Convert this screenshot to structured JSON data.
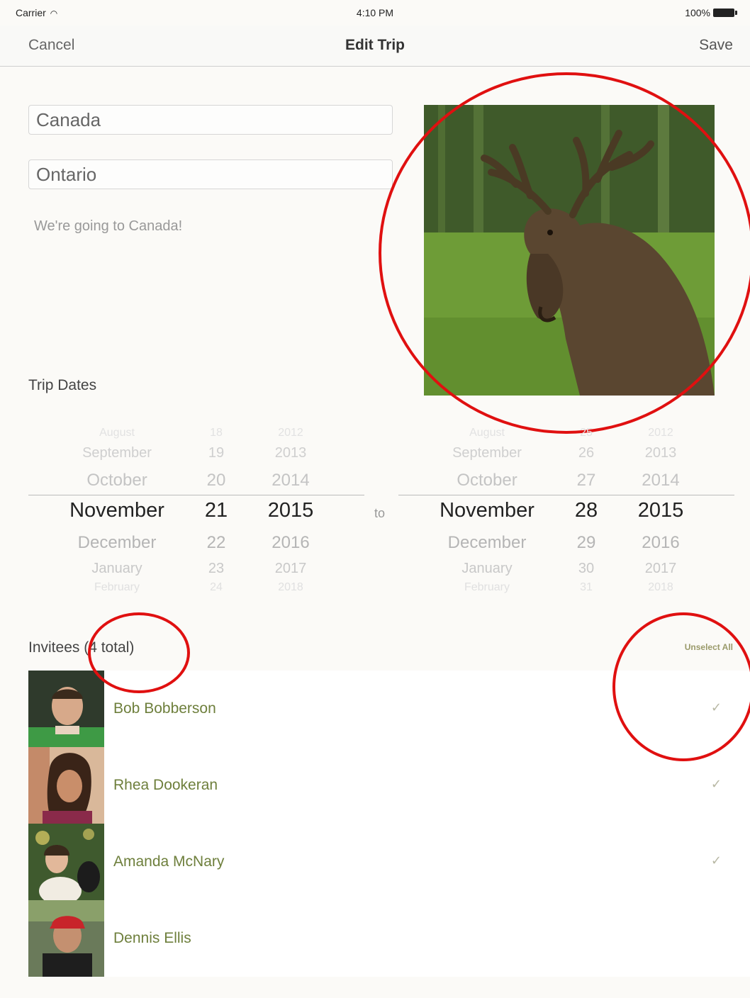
{
  "status_bar": {
    "carrier": "Carrier",
    "time": "4:10 PM",
    "battery": "100%"
  },
  "nav": {
    "cancel": "Cancel",
    "title": "Edit Trip",
    "save": "Save"
  },
  "form": {
    "country": "Canada",
    "region": "Ontario",
    "notes": "We're going to Canada!"
  },
  "trip_dates": {
    "title": "Trip Dates",
    "to_label": "to",
    "start": {
      "months": [
        "August",
        "September",
        "October",
        "November",
        "December",
        "January",
        "February"
      ],
      "days": [
        "18",
        "19",
        "20",
        "21",
        "22",
        "23",
        "24"
      ],
      "years": [
        "2012",
        "2013",
        "2014",
        "2015",
        "2016",
        "2017",
        "2018"
      ]
    },
    "end": {
      "months": [
        "August",
        "September",
        "October",
        "November",
        "December",
        "January",
        "February"
      ],
      "days": [
        "25",
        "26",
        "27",
        "28",
        "29",
        "30",
        "31"
      ],
      "years": [
        "2012",
        "2013",
        "2014",
        "2015",
        "2016",
        "2017",
        "2018"
      ]
    }
  },
  "invitees": {
    "title": "Invitees (4 total)",
    "unselect_all": "Unselect All",
    "people": [
      {
        "name": "Bob Bobberson",
        "selected": true,
        "check": "✓"
      },
      {
        "name": "Rhea Dookeran",
        "selected": true,
        "check": "✓"
      },
      {
        "name": "Amanda McNary",
        "selected": true,
        "check": "✓"
      },
      {
        "name": "Dennis Ellis",
        "selected": false,
        "check": ""
      }
    ]
  },
  "colors": {
    "annotation_red": "#e01010",
    "invitee_name": "#6e7f3c",
    "background": "#fbfaf7"
  }
}
